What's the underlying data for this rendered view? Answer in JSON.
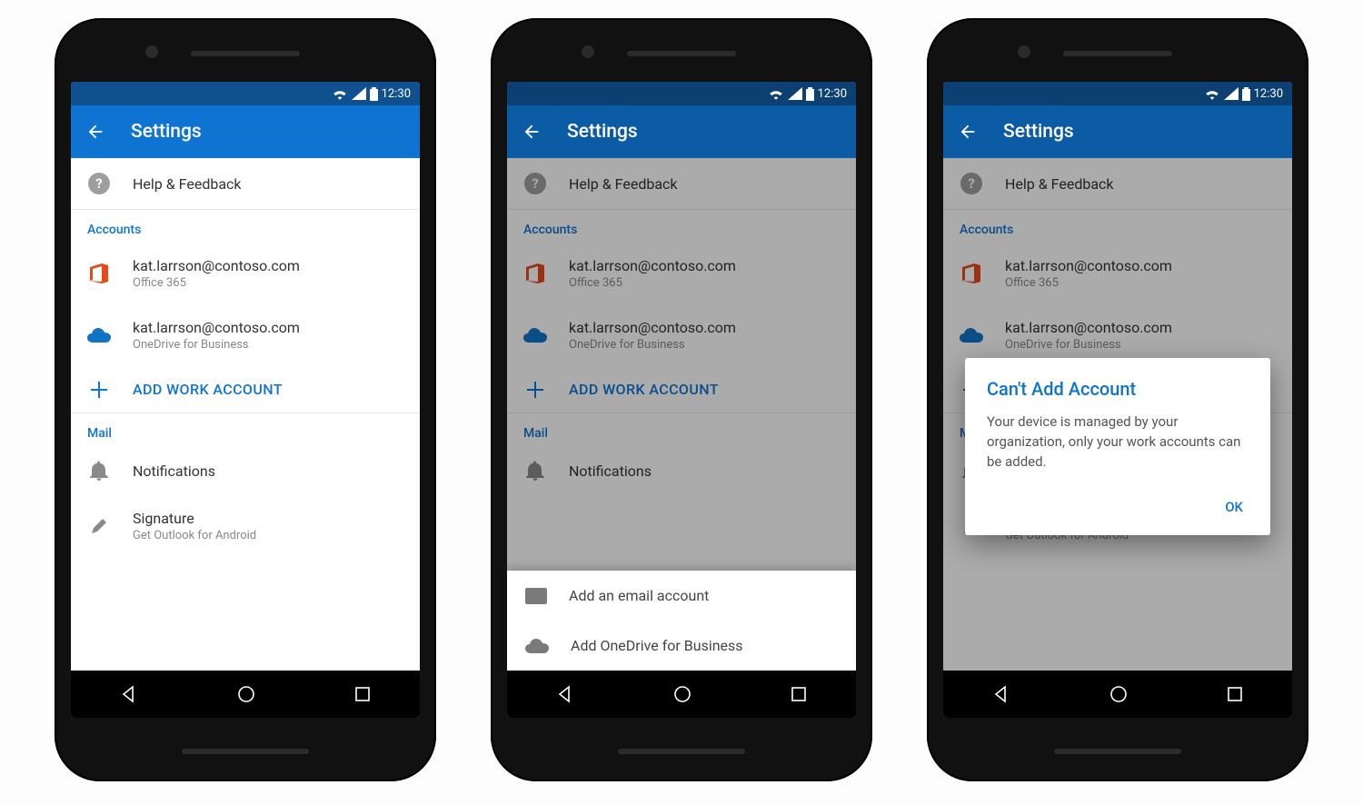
{
  "status": {
    "time": "12:30"
  },
  "appbar": {
    "title": "Settings"
  },
  "help": {
    "label": "Help & Feedback"
  },
  "sections": {
    "accounts": {
      "label": "Accounts"
    },
    "mail": {
      "label": "Mail"
    }
  },
  "accounts": [
    {
      "email": "kat.larrson@contoso.com",
      "provider": "Office 365",
      "icon": "office365"
    },
    {
      "email": "kat.larrson@contoso.com",
      "provider": "OneDrive for Business",
      "icon": "onedrive"
    }
  ],
  "addWork": {
    "label": "ADD WORK ACCOUNT"
  },
  "mail": {
    "notifications": {
      "label": "Notifications"
    },
    "signature": {
      "label": "Signature",
      "sub": "Get Outlook for Android"
    }
  },
  "sheet": {
    "email": "Add an email account",
    "onedrive": "Add OneDrive for Business"
  },
  "dialog": {
    "title": "Can't Add Account",
    "body": "Your device is managed by your organization, only your work accounts can be added.",
    "ok": "OK"
  }
}
